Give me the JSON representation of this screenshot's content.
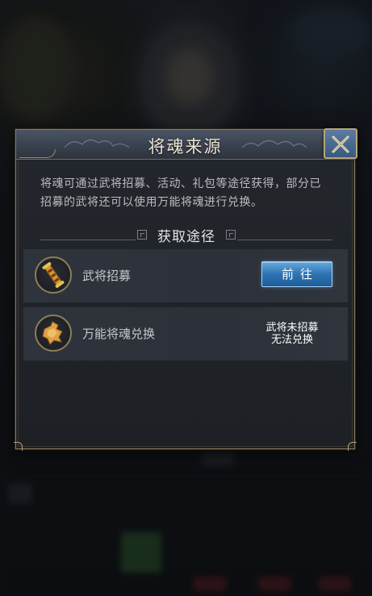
{
  "dialog": {
    "title": "将魂来源",
    "close_icon": "close-icon",
    "description": "将魂可通过武将招募、活动、礼包等途径获得，部分已招募的武将还可以使用万能将魂进行兑换。",
    "section_title": "获取途径"
  },
  "sources": [
    {
      "label": "武将招募",
      "icon": "recruit-scroll-icon",
      "action_label": "前往"
    },
    {
      "label": "万能将魂兑换",
      "icon": "universal-soul-fragment-icon",
      "status_line1": "武将未招募",
      "status_line2": "无法兑换"
    }
  ],
  "colors": {
    "gold_frame": "#8a7a58",
    "title_bar": "#3d4653",
    "action_blue": "#2e74b4",
    "panel": "#1f2227"
  }
}
